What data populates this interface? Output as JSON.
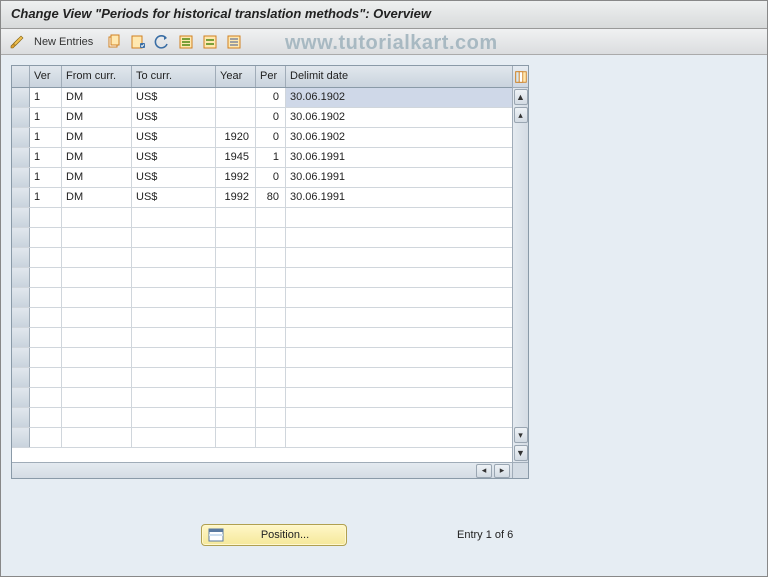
{
  "title": "Change View \"Periods for historical translation methods\": Overview",
  "toolbar": {
    "new_entries_label": "New Entries"
  },
  "watermark": "www.tutorialkart.com",
  "table": {
    "headers": {
      "ver": "Ver",
      "from": "From curr.",
      "to": "To curr.",
      "year": "Year",
      "per": "Per",
      "delimit": "Delimit date"
    },
    "rows": [
      {
        "ver": "1",
        "from": "DM",
        "to": "US$",
        "year": "",
        "per": "0",
        "delimit": "30.06.1902",
        "selected": true
      },
      {
        "ver": "1",
        "from": "DM",
        "to": "US$",
        "year": "",
        "per": "0",
        "delimit": "30.06.1902"
      },
      {
        "ver": "1",
        "from": "DM",
        "to": "US$",
        "year": "1920",
        "per": "0",
        "delimit": "30.06.1902"
      },
      {
        "ver": "1",
        "from": "DM",
        "to": "US$",
        "year": "1945",
        "per": "1",
        "delimit": "30.06.1991"
      },
      {
        "ver": "1",
        "from": "DM",
        "to": "US$",
        "year": "1992",
        "per": "0",
        "delimit": "30.06.1991"
      },
      {
        "ver": "1",
        "from": "DM",
        "to": "US$",
        "year": "1992",
        "per": "80",
        "delimit": "30.06.1991"
      }
    ],
    "empty_row_count": 12
  },
  "footer": {
    "position_label": "Position...",
    "entry_text": "Entry 1 of 6"
  },
  "icons": {
    "pencils": "toggle-change-icon",
    "copy": "copy-icon",
    "save": "save-icon",
    "undo": "undo-icon",
    "select_all": "select-all-icon",
    "select_block": "select-block-icon",
    "deselect": "deselect-icon",
    "config": "table-settings-icon"
  }
}
